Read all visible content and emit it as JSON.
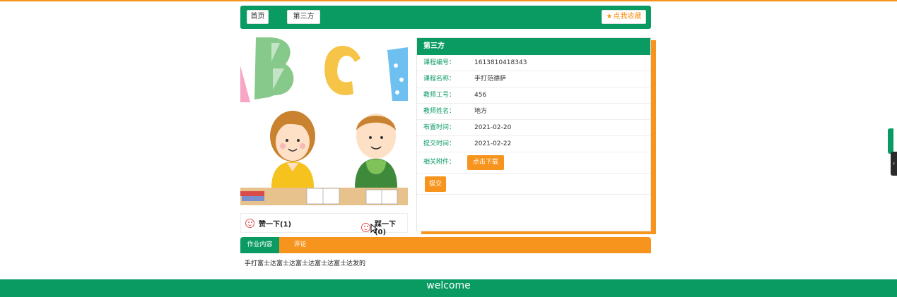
{
  "nav": {
    "home_label": "首页",
    "category_label": "第三方",
    "favorite_label": "点我收藏"
  },
  "votes": {
    "up_label": "赞一下(1)",
    "down_label": "踩一下(0)"
  },
  "detail": {
    "title": "第三方",
    "fields": [
      {
        "label": "课程编号：",
        "value": "1613810418343"
      },
      {
        "label": "课程名称：",
        "value": "手打范德萨"
      },
      {
        "label": "教师工号：",
        "value": "456"
      },
      {
        "label": "教师姓名：",
        "value": "地方"
      },
      {
        "label": "布置时间：",
        "value": "2021-02-20"
      },
      {
        "label": "提交时间：",
        "value": "2021-02-22"
      }
    ],
    "attachment_label": "相关附件：",
    "download_label": "点击下载",
    "submit_label": "提交"
  },
  "tabs": {
    "content_label": "作业内容",
    "comment_label": "评论"
  },
  "content_text": "手打富士达富士达富士达富士达富士达发的",
  "footer_text": "welcome",
  "colors": {
    "primary_green": "#0a9b63",
    "accent_orange": "#f7941d"
  }
}
